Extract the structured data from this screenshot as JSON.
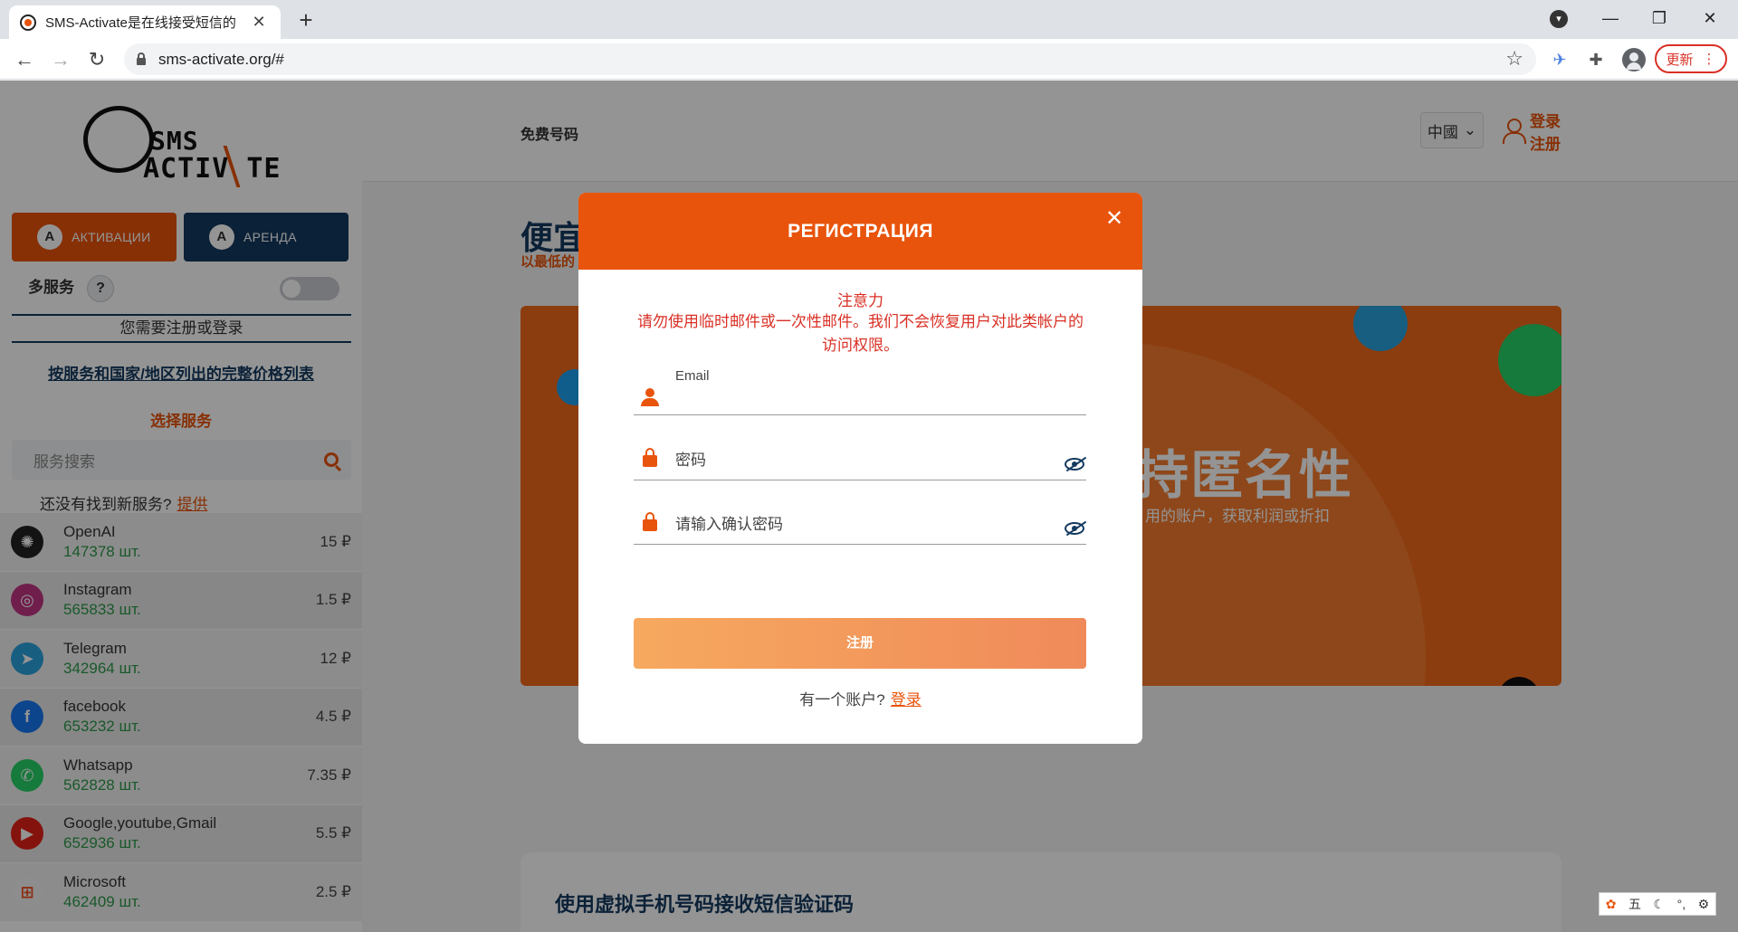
{
  "browser": {
    "tab_title": "SMS-Activate是在线接受短信的",
    "tab_close": "✕",
    "new_tab": "+",
    "url": "sms-activate.org/#",
    "update_label": "更新",
    "win_min": "—",
    "win_max": "❐",
    "win_close": "✕"
  },
  "logo": {
    "line1": "SMS",
    "line2": "ACTIV TE"
  },
  "sidebar": {
    "activations_label": "АКТИВАЦИИ",
    "rent_label": "АРЕНДА",
    "multiservice_label": "多服务",
    "help_mark": "?",
    "register_note": "您需要注册或登录",
    "price_list_link": "按服务和国家/地区列出的完整价格列表",
    "choose_service": "选择服务",
    "search_placeholder": "服务搜索",
    "not_found_text": "还没有找到新服务?",
    "suggest_link": "提供",
    "services": [
      {
        "name": "OpenAI",
        "count": "147378 шт.",
        "price": "15 ₽",
        "icon": "openai-icon",
        "color": "#222222",
        "glyph": "✺"
      },
      {
        "name": "Instagram",
        "count": "565833 шт.",
        "price": "1.5 ₽",
        "icon": "instagram-icon",
        "color": "#c13584",
        "glyph": "◎"
      },
      {
        "name": "Telegram",
        "count": "342964 шт.",
        "price": "12 ₽",
        "icon": "telegram-icon",
        "color": "#2aa3df",
        "glyph": "➤"
      },
      {
        "name": "facebook",
        "count": "653232 шт.",
        "price": "4.5 ₽",
        "icon": "facebook-icon",
        "color": "#1877f2",
        "glyph": "f"
      },
      {
        "name": "Whatsapp",
        "count": "562828 шт.",
        "price": "7.35 ₽",
        "icon": "whatsapp-icon",
        "color": "#25d366",
        "glyph": "✆"
      },
      {
        "name": "Google,youtube,Gmail",
        "count": "652936 шт.",
        "price": "5.5 ₽",
        "icon": "youtube-icon",
        "color": "#e62117",
        "glyph": "▶"
      },
      {
        "name": "Microsoft",
        "count": "462409 шт.",
        "price": "2.5 ₽",
        "icon": "microsoft-icon",
        "color": "#f3f3f3",
        "glyph": "⊞"
      }
    ]
  },
  "header": {
    "free_numbers": "免费号码",
    "language": "中國",
    "login": "登录",
    "register": "注册"
  },
  "hero": {
    "title": "便宜",
    "subtitle": "以最低的",
    "banner_heading": "持匿名性",
    "banner_text": "用的账户，获取利润或折扣"
  },
  "bottom_card": {
    "title": "使用虚拟手机号码接收短信验证码"
  },
  "modal": {
    "title": "РЕГИСТРАЦИЯ",
    "close": "✕",
    "warning_title": "注意力",
    "warning_text": "请勿使用临时邮件或一次性邮件。我们不会恢复用户对此类帐户的访问权限。",
    "email_label": "Email",
    "password_placeholder": "密码",
    "confirm_placeholder": "请输入确认密码",
    "submit_label": "注册",
    "have_account": "有一个账户?",
    "login_link": "登录"
  },
  "ime": {
    "mode": "五"
  },
  "colors": {
    "brand_orange": "#e8540c",
    "navy": "#14395f",
    "count_green": "#2e9a4b",
    "warning_red": "#d93025"
  }
}
